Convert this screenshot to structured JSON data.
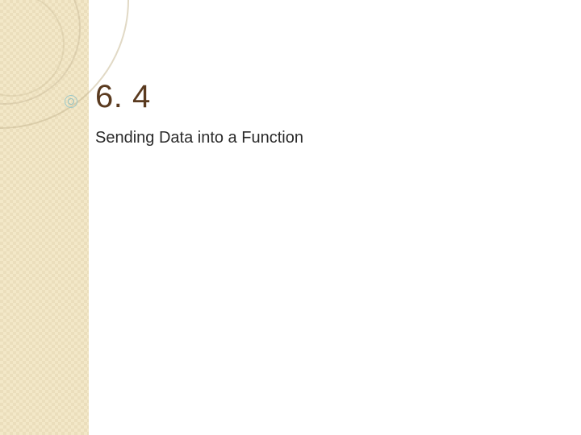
{
  "slide": {
    "section_number": "6. 4",
    "subtitle": "Sending Data into a Function"
  },
  "theme": {
    "band_color": "#f3e8c8",
    "title_color": "#5a3a1f",
    "accent_color": "#8fbfbf"
  }
}
